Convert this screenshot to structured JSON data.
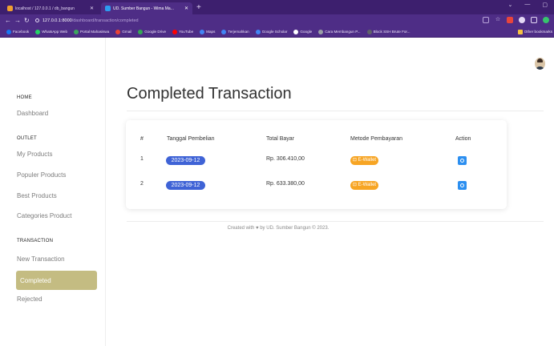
{
  "browser": {
    "tabs": [
      {
        "title": "localhost / 127.0.0.1 / db_bangun",
        "active": false
      },
      {
        "title": "UD. Sumber Bangun - Wima Ma...",
        "active": true
      }
    ],
    "url_host": "127.0.0.1:8000",
    "url_path": "/dashboard/transaction/completed",
    "bookmarks": [
      {
        "label": "Facebook",
        "color": "#1877f2"
      },
      {
        "label": "WhatsApp Web",
        "color": "#25d366"
      },
      {
        "label": "Portal Mahasiswa",
        "color": "#3ba55d"
      },
      {
        "label": "Gmail",
        "color": "#ea4335"
      },
      {
        "label": "Google Drive",
        "color": "#34a853"
      },
      {
        "label": "YouTube",
        "color": "#ff0000"
      },
      {
        "label": "Maps",
        "color": "#4285f4"
      },
      {
        "label": "Terjemahkan",
        "color": "#4285f4"
      },
      {
        "label": "Google Scholar",
        "color": "#4285f4"
      },
      {
        "label": "Google",
        "color": "#ffffff"
      },
      {
        "label": "Cara Membangun P...",
        "color": "#9aa0a6"
      },
      {
        "label": "Block SSH Brute For...",
        "color": "#5f6368"
      }
    ],
    "other_bookmarks": "Other bookmarks"
  },
  "sidebar": {
    "home_heading": "HOME",
    "dashboard": "Dashboard",
    "outlet_heading": "OUTLET",
    "outlet_items": [
      "My Products",
      "Populer Products",
      "Best Products",
      "Categories Product"
    ],
    "transaction_heading": "TRANSACTION",
    "new_transaction": "New Transaction",
    "completed": "Completed",
    "rejected": "Rejected"
  },
  "main": {
    "title": "Completed Transaction",
    "table": {
      "headers": [
        "#",
        "Tanggal Pembelian",
        "Total Bayar",
        "Metode Pembayaran",
        "Action"
      ],
      "rows": [
        {
          "no": "1",
          "date": "2023-09-12",
          "total": "Rp. 306.410,00",
          "method": "E-Wallet"
        },
        {
          "no": "2",
          "date": "2023-09-12",
          "total": "Rp. 633.380,00",
          "method": "E-Wallet"
        }
      ]
    },
    "footer": "Created with ♥ by UD. Sumber Bangun © 2023."
  },
  "colors": {
    "sidebar_active": "#c4bc82",
    "date_badge": "#3f63d6",
    "wallet_badge": "#f7a524",
    "action_button": "#2c8ff0",
    "browser_frame": "#4e2d86"
  }
}
